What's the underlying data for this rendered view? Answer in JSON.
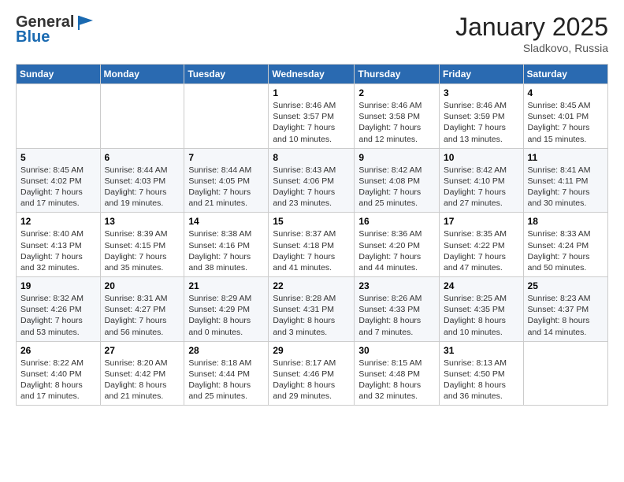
{
  "logo": {
    "line1": "General",
    "line2": "Blue"
  },
  "title": "January 2025",
  "location": "Sladkovo, Russia",
  "weekdays": [
    "Sunday",
    "Monday",
    "Tuesday",
    "Wednesday",
    "Thursday",
    "Friday",
    "Saturday"
  ],
  "weeks": [
    [
      {
        "num": "",
        "text": ""
      },
      {
        "num": "",
        "text": ""
      },
      {
        "num": "",
        "text": ""
      },
      {
        "num": "1",
        "text": "Sunrise: 8:46 AM\nSunset: 3:57 PM\nDaylight: 7 hours\nand 10 minutes."
      },
      {
        "num": "2",
        "text": "Sunrise: 8:46 AM\nSunset: 3:58 PM\nDaylight: 7 hours\nand 12 minutes."
      },
      {
        "num": "3",
        "text": "Sunrise: 8:46 AM\nSunset: 3:59 PM\nDaylight: 7 hours\nand 13 minutes."
      },
      {
        "num": "4",
        "text": "Sunrise: 8:45 AM\nSunset: 4:01 PM\nDaylight: 7 hours\nand 15 minutes."
      }
    ],
    [
      {
        "num": "5",
        "text": "Sunrise: 8:45 AM\nSunset: 4:02 PM\nDaylight: 7 hours\nand 17 minutes."
      },
      {
        "num": "6",
        "text": "Sunrise: 8:44 AM\nSunset: 4:03 PM\nDaylight: 7 hours\nand 19 minutes."
      },
      {
        "num": "7",
        "text": "Sunrise: 8:44 AM\nSunset: 4:05 PM\nDaylight: 7 hours\nand 21 minutes."
      },
      {
        "num": "8",
        "text": "Sunrise: 8:43 AM\nSunset: 4:06 PM\nDaylight: 7 hours\nand 23 minutes."
      },
      {
        "num": "9",
        "text": "Sunrise: 8:42 AM\nSunset: 4:08 PM\nDaylight: 7 hours\nand 25 minutes."
      },
      {
        "num": "10",
        "text": "Sunrise: 8:42 AM\nSunset: 4:10 PM\nDaylight: 7 hours\nand 27 minutes."
      },
      {
        "num": "11",
        "text": "Sunrise: 8:41 AM\nSunset: 4:11 PM\nDaylight: 7 hours\nand 30 minutes."
      }
    ],
    [
      {
        "num": "12",
        "text": "Sunrise: 8:40 AM\nSunset: 4:13 PM\nDaylight: 7 hours\nand 32 minutes."
      },
      {
        "num": "13",
        "text": "Sunrise: 8:39 AM\nSunset: 4:15 PM\nDaylight: 7 hours\nand 35 minutes."
      },
      {
        "num": "14",
        "text": "Sunrise: 8:38 AM\nSunset: 4:16 PM\nDaylight: 7 hours\nand 38 minutes."
      },
      {
        "num": "15",
        "text": "Sunrise: 8:37 AM\nSunset: 4:18 PM\nDaylight: 7 hours\nand 41 minutes."
      },
      {
        "num": "16",
        "text": "Sunrise: 8:36 AM\nSunset: 4:20 PM\nDaylight: 7 hours\nand 44 minutes."
      },
      {
        "num": "17",
        "text": "Sunrise: 8:35 AM\nSunset: 4:22 PM\nDaylight: 7 hours\nand 47 minutes."
      },
      {
        "num": "18",
        "text": "Sunrise: 8:33 AM\nSunset: 4:24 PM\nDaylight: 7 hours\nand 50 minutes."
      }
    ],
    [
      {
        "num": "19",
        "text": "Sunrise: 8:32 AM\nSunset: 4:26 PM\nDaylight: 7 hours\nand 53 minutes."
      },
      {
        "num": "20",
        "text": "Sunrise: 8:31 AM\nSunset: 4:27 PM\nDaylight: 7 hours\nand 56 minutes."
      },
      {
        "num": "21",
        "text": "Sunrise: 8:29 AM\nSunset: 4:29 PM\nDaylight: 8 hours\nand 0 minutes."
      },
      {
        "num": "22",
        "text": "Sunrise: 8:28 AM\nSunset: 4:31 PM\nDaylight: 8 hours\nand 3 minutes."
      },
      {
        "num": "23",
        "text": "Sunrise: 8:26 AM\nSunset: 4:33 PM\nDaylight: 8 hours\nand 7 minutes."
      },
      {
        "num": "24",
        "text": "Sunrise: 8:25 AM\nSunset: 4:35 PM\nDaylight: 8 hours\nand 10 minutes."
      },
      {
        "num": "25",
        "text": "Sunrise: 8:23 AM\nSunset: 4:37 PM\nDaylight: 8 hours\nand 14 minutes."
      }
    ],
    [
      {
        "num": "26",
        "text": "Sunrise: 8:22 AM\nSunset: 4:40 PM\nDaylight: 8 hours\nand 17 minutes."
      },
      {
        "num": "27",
        "text": "Sunrise: 8:20 AM\nSunset: 4:42 PM\nDaylight: 8 hours\nand 21 minutes."
      },
      {
        "num": "28",
        "text": "Sunrise: 8:18 AM\nSunset: 4:44 PM\nDaylight: 8 hours\nand 25 minutes."
      },
      {
        "num": "29",
        "text": "Sunrise: 8:17 AM\nSunset: 4:46 PM\nDaylight: 8 hours\nand 29 minutes."
      },
      {
        "num": "30",
        "text": "Sunrise: 8:15 AM\nSunset: 4:48 PM\nDaylight: 8 hours\nand 32 minutes."
      },
      {
        "num": "31",
        "text": "Sunrise: 8:13 AM\nSunset: 4:50 PM\nDaylight: 8 hours\nand 36 minutes."
      },
      {
        "num": "",
        "text": ""
      }
    ]
  ]
}
